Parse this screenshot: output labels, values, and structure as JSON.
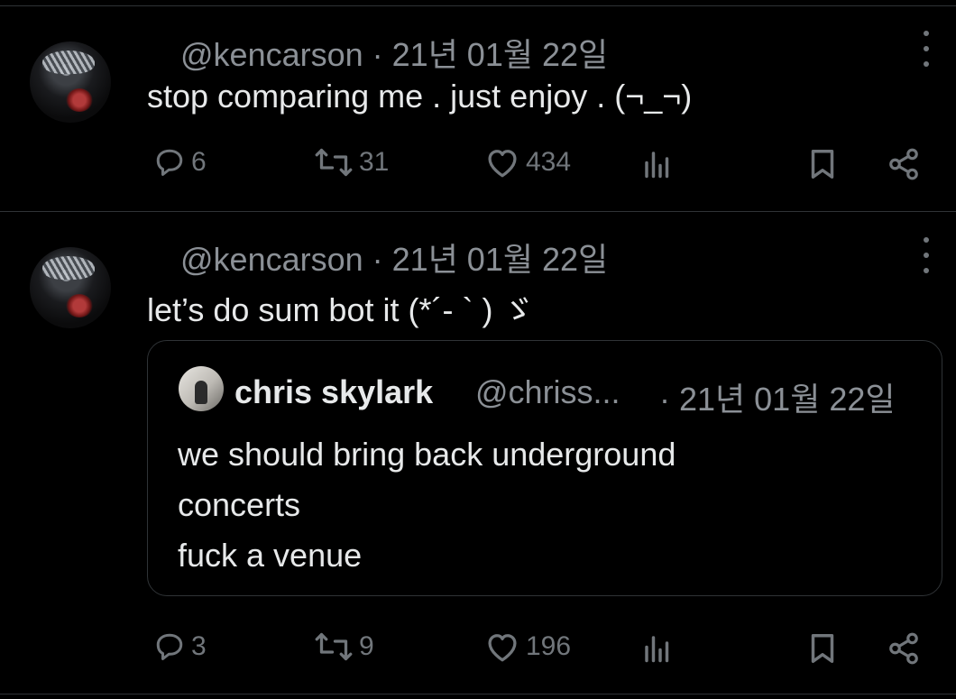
{
  "tweets": [
    {
      "handle": "@kencarson",
      "date": "· 21년 01월 22일",
      "text": "stop comparing me . just enjoy . (¬_¬)",
      "replies": "6",
      "reposts": "31",
      "likes": "434",
      "views": ""
    },
    {
      "handle": "@kencarson",
      "date": "· 21년 01월 22일",
      "text": "let’s do sum bot it (*´- ` ) ゞ",
      "replies": "3",
      "reposts": "9",
      "likes": "196",
      "views": "",
      "quote": {
        "name": "chris skylark",
        "handle": "@chriss...",
        "date": "· 21년 01월 22일",
        "lines": [
          "we should bring back underground",
          "concerts",
          "fuck a venue"
        ]
      }
    }
  ],
  "icons": {
    "reply": "reply-icon",
    "repost": "repost-icon",
    "like": "heart-icon",
    "views": "views-icon",
    "bookmark": "bookmark-icon",
    "share": "share-icon",
    "more": "more-icon"
  },
  "colors": {
    "background": "#000000",
    "text": "#e7e9ea",
    "muted": "#71767b",
    "border": "#2f3336"
  }
}
